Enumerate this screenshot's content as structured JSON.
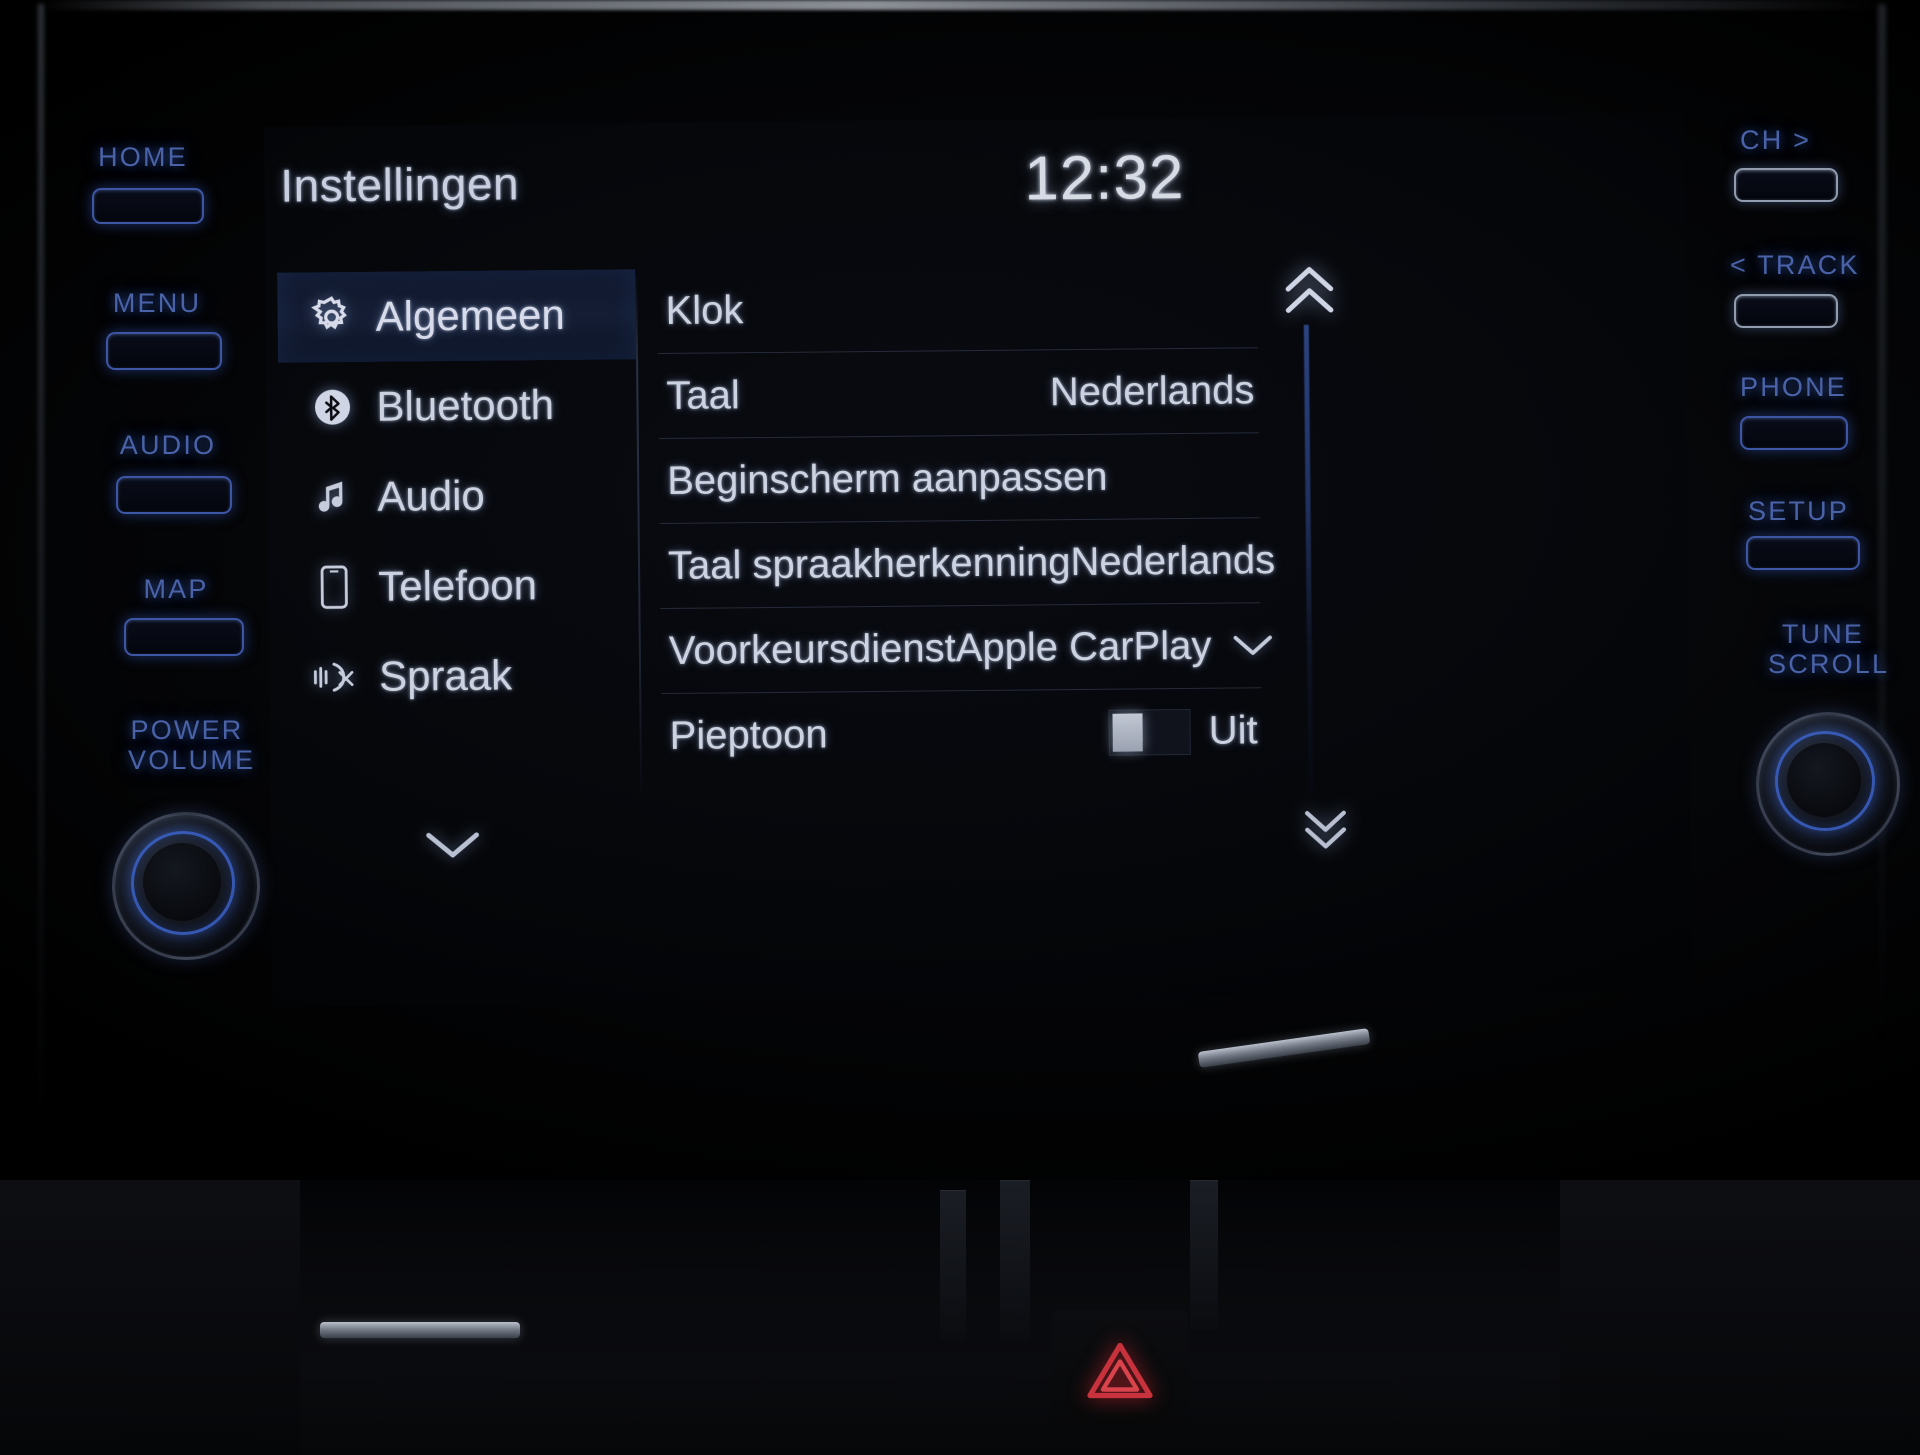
{
  "screen": {
    "title": "Instellingen",
    "clock": "12:32",
    "categories": [
      {
        "label": "Algemeen",
        "icon": "gear-icon",
        "selected": true
      },
      {
        "label": "Bluetooth",
        "icon": "bluetooth-icon",
        "selected": false
      },
      {
        "label": "Audio",
        "icon": "music-note-icon",
        "selected": false
      },
      {
        "label": "Telefoon",
        "icon": "phone-icon",
        "selected": false
      },
      {
        "label": "Spraak",
        "icon": "voice-icon",
        "selected": false
      }
    ],
    "category_more_icon": "chevron-down-icon",
    "rows": [
      {
        "label": "Klok",
        "value": "",
        "control": "none"
      },
      {
        "label": "Taal",
        "value": "Nederlands",
        "control": "none"
      },
      {
        "label": "Beginscherm aanpassen",
        "value": "",
        "control": "none"
      },
      {
        "label": "Taal spraakherkenning",
        "value": "Nederlands",
        "control": "none"
      },
      {
        "label": "Voorkeursdienst",
        "value": "Apple CarPlay",
        "control": "chevron"
      },
      {
        "label": "Pieptoon",
        "value": "Uit",
        "control": "toggle"
      }
    ],
    "scroll_up_icon": "double-chevron-up-icon",
    "scroll_down_icon": "double-chevron-down-icon",
    "accent_blue": "#3a5aaa",
    "text_color": "#ccd2e0"
  },
  "hardware": {
    "left_buttons": [
      {
        "label": "HOME"
      },
      {
        "label": "MENU"
      },
      {
        "label": "AUDIO"
      },
      {
        "label": "MAP"
      }
    ],
    "left_knob_label_line1": "POWER",
    "left_knob_label_line2": "VOLUME",
    "right_buttons": [
      {
        "label": "CH >"
      },
      {
        "label": "< TRACK"
      },
      {
        "label": "PHONE"
      },
      {
        "label": "SETUP"
      }
    ],
    "right_knob_label_line1": "TUNE",
    "right_knob_label_line2": "SCROLL",
    "hazard_icon": "hazard-triangle-icon",
    "button_glow_color": "#3f62c0"
  }
}
